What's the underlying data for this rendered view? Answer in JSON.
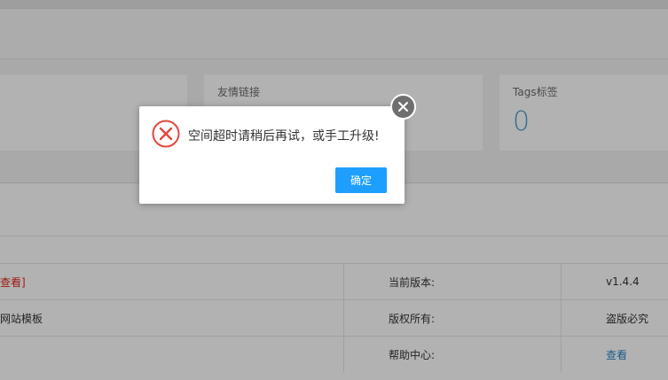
{
  "stats": [
    {
      "title": "",
      "value": ""
    },
    {
      "title": "友情链接",
      "value": ""
    },
    {
      "title": "Tags标签",
      "value": "0"
    }
  ],
  "info_table": {
    "rows": [
      {
        "left": "查看]",
        "label": "当前版本:",
        "value": "v1.4.4"
      },
      {
        "left": "网站模板",
        "label": "版权所有:",
        "value": "盗版必究"
      },
      {
        "left": "",
        "label": "帮助中心:",
        "value": "查看"
      }
    ]
  },
  "dialog": {
    "message": "空间超时请稍后再试，或手工升级!",
    "ok_label": "确定",
    "icon": "error-icon",
    "close_icon": "close-icon"
  },
  "colors": {
    "primary_button": "#1e9fff",
    "error_icon": "#e3483c",
    "stat_value": "#4f9ccd",
    "link_red": "#e0241b",
    "link_blue": "#2a86c8"
  }
}
